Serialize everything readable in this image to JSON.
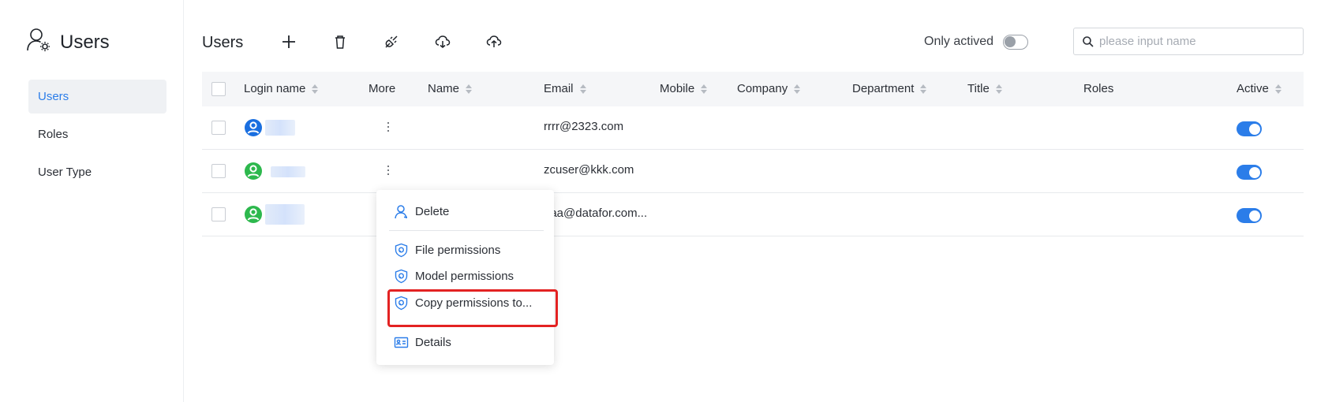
{
  "app": {
    "title": "Users",
    "icon": "user-settings-icon"
  },
  "sidebar": {
    "items": [
      {
        "label": "Users",
        "active": true
      },
      {
        "label": "Roles",
        "active": false
      },
      {
        "label": "User Type",
        "active": false
      }
    ]
  },
  "toolbar": {
    "title": "Users",
    "buttons": [
      {
        "icon": "plus-icon"
      },
      {
        "icon": "trash-icon"
      },
      {
        "icon": "plug-icon"
      },
      {
        "icon": "cloud-download-icon"
      },
      {
        "icon": "cloud-upload-icon"
      }
    ],
    "only_actived_label": "Only actived",
    "only_actived_on": false
  },
  "search": {
    "placeholder": "please input name",
    "value": ""
  },
  "table": {
    "columns": [
      "Login name",
      "More",
      "Name",
      "Email",
      "Mobile",
      "Company",
      "Department",
      "Title",
      "Roles",
      "Active"
    ],
    "rows": [
      {
        "avatar_color": "#1a6fe0",
        "login_name": "",
        "name": "",
        "email": "rrrr@2323.com",
        "mobile": "",
        "company": "",
        "department": "",
        "title": "",
        "roles": "",
        "active": true
      },
      {
        "avatar_color": "#2db84d",
        "login_name": "",
        "name": "",
        "email": "zcuser@kkk.com",
        "mobile": "",
        "company": "",
        "department": "",
        "title": "",
        "roles": "",
        "active": true
      },
      {
        "avatar_color": "#2db84d",
        "login_name": "",
        "name": "",
        "email": "aaa@datafor.com...",
        "mobile": "",
        "company": "",
        "department": "",
        "title": "",
        "roles": "",
        "active": true
      }
    ]
  },
  "context_menu": {
    "items": [
      {
        "label": "Delete",
        "icon": "user-icon"
      },
      {
        "label": "File permissions",
        "icon": "shield-icon"
      },
      {
        "label": "Model permissions",
        "icon": "shield-icon"
      },
      {
        "label": "Copy permissions to...",
        "icon": "shield-icon",
        "highlighted": true
      },
      {
        "label": "Details",
        "icon": "id-card-icon"
      }
    ]
  },
  "colors": {
    "accent": "#2b7de9",
    "highlight_border": "#e32222",
    "header_bg": "#f5f6f8"
  }
}
